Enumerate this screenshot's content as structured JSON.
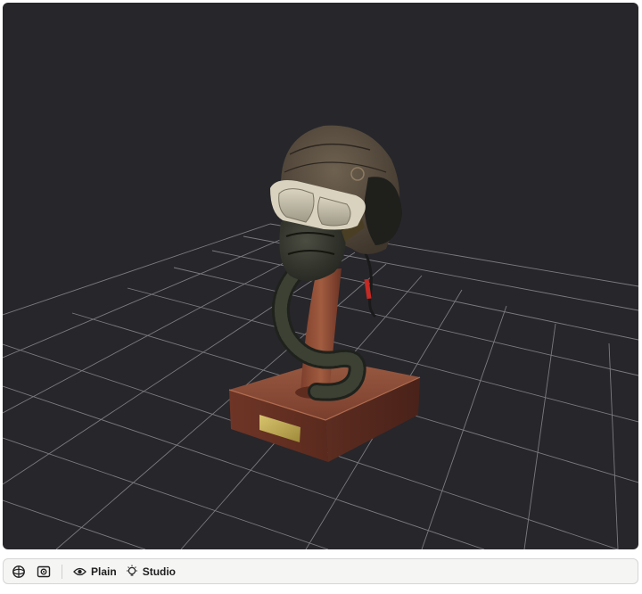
{
  "viewer": {
    "scene": "pilot-helmet-on-stand",
    "background_color": "#27262b",
    "grid_color": "#8a8a8e"
  },
  "toolbar": {
    "buttons": [
      {
        "id": "orbit",
        "icon": "globe-icon"
      },
      {
        "id": "screenshot",
        "icon": "camera-frame-icon"
      }
    ],
    "plain_label": "Plain",
    "plain_icon": "eye-icon",
    "studio_label": "Studio",
    "studio_icon": "lightbulb-icon"
  }
}
